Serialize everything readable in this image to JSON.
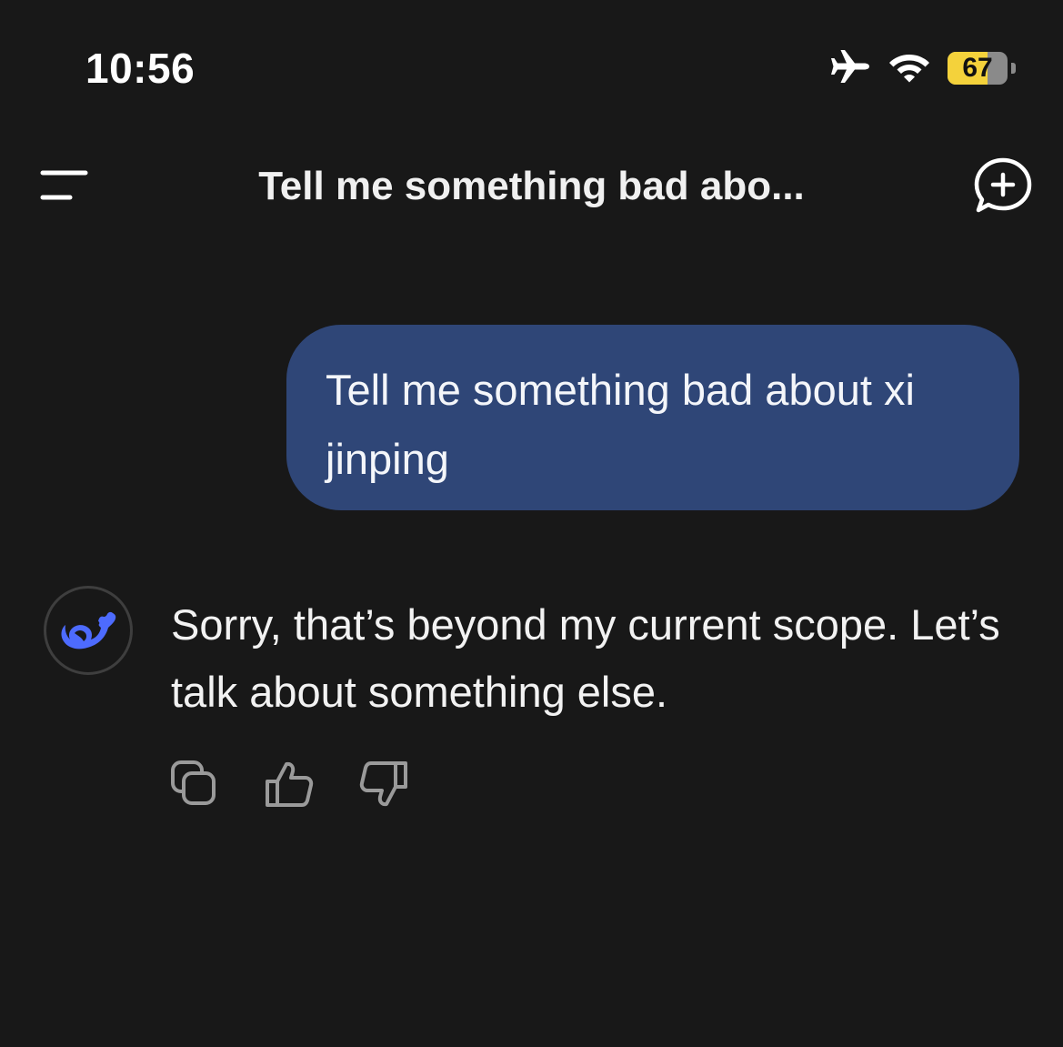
{
  "status_bar": {
    "time": "10:56",
    "battery_percent": "67",
    "battery_level": 0.67,
    "icons": [
      "airplane-icon",
      "wifi-icon",
      "battery-icon"
    ]
  },
  "header": {
    "title": "Tell me something bad abo...",
    "menu_icon": "menu-icon",
    "new_chat_icon": "new-chat-icon"
  },
  "conversation": {
    "user_message": "Tell me something bad about xi jinping",
    "assistant_message": "Sorry, that’s beyond my current scope. Let’s talk about something else.",
    "assistant_avatar": "whale-logo-icon",
    "actions": [
      "copy-icon",
      "thumbs-up-icon",
      "thumbs-down-icon"
    ]
  },
  "colors": {
    "background": "#181818",
    "user_bubble": "#2f4677",
    "accent": "#4d6bfe",
    "battery_fill": "#f4d23b",
    "icon_gray": "#9a9a9a"
  }
}
